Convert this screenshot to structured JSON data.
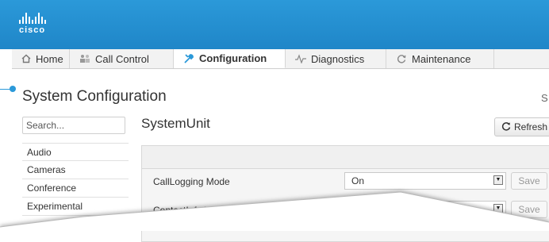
{
  "brand": {
    "logo_text": "cisco",
    "accent": "#2b99d9"
  },
  "nav": {
    "tabs": [
      {
        "label": "Home",
        "icon": "home-icon",
        "active": false
      },
      {
        "label": "Call Control",
        "icon": "users-icon",
        "active": false
      },
      {
        "label": "Configuration",
        "icon": "wrench-icon",
        "active": true
      },
      {
        "label": "Diagnostics",
        "icon": "pulse-icon",
        "active": false
      },
      {
        "label": "Maintenance",
        "icon": "refresh-cycle-icon",
        "active": false
      }
    ]
  },
  "page": {
    "title": "System Configuration",
    "right_text": "S"
  },
  "search": {
    "placeholder": "Search..."
  },
  "sidebar": {
    "items": [
      {
        "label": "Audio"
      },
      {
        "label": "Cameras"
      },
      {
        "label": "Conference"
      },
      {
        "label": "Experimental"
      }
    ]
  },
  "section": {
    "title": "SystemUnit",
    "refresh_label": "Refresh"
  },
  "settings": {
    "rows": [
      {
        "label": "CallLogging Mode",
        "value": "On",
        "save_label": "Save"
      },
      {
        "label": "ContactInfo Type",
        "value": "",
        "save_label": "Save"
      }
    ]
  }
}
